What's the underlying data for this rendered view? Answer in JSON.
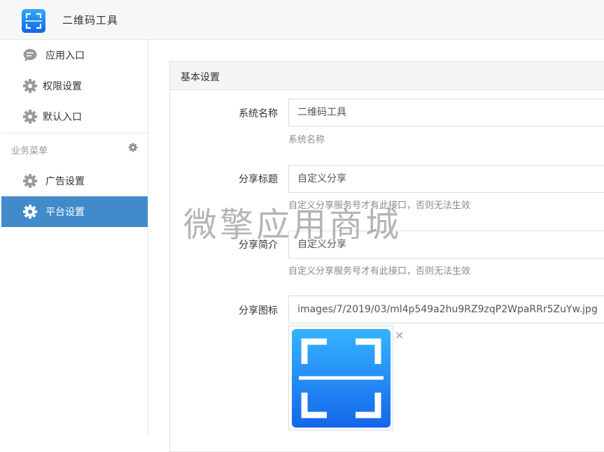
{
  "header": {
    "app_title": "二维码工具",
    "logo_icon": "qr-scan-icon"
  },
  "sidebar": {
    "items": [
      {
        "label": "应用入口",
        "icon": "chat-icon"
      },
      {
        "label": "权限设置",
        "icon": "gear-icon"
      },
      {
        "label": "默认入口",
        "icon": "gear-icon"
      }
    ],
    "section_label": "业务菜单",
    "section_icon": "gear-icon",
    "business_items": [
      {
        "label": "广告设置",
        "icon": "gear-icon"
      },
      {
        "label": "平台设置",
        "icon": "gear-icon",
        "active": true
      }
    ]
  },
  "panel": {
    "title": "基本设置",
    "fields": [
      {
        "label": "系统名称",
        "value": "二维码工具",
        "help": "系统名称"
      },
      {
        "label": "分享标题",
        "value": "自定义分享",
        "help": "自定义分享服务号才有此接口，否则无法生效"
      },
      {
        "label": "分享简介",
        "value": "自定义分享",
        "help": "自定义分享服务号才有此接口，否则无法生效"
      },
      {
        "label": "分享图标",
        "value": "images/7/2019/03/ml4p549a2hu9RZ9zqP2WpaRRr5ZuYw.jpg"
      }
    ],
    "remove_glyph": "×"
  },
  "watermark": "微擎应用商城",
  "colors": {
    "active_bg": "#428bca",
    "logo_gradient_top": "#2fa9ff",
    "logo_gradient_bottom": "#1565e8"
  }
}
